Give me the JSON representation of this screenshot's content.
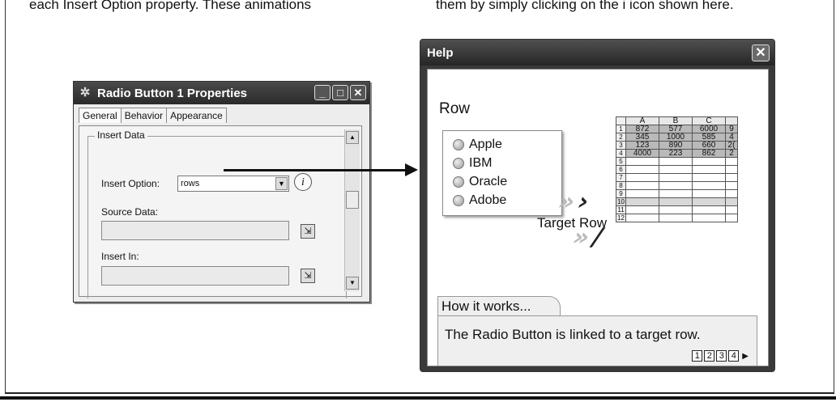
{
  "intro_text": {
    "left": "each Insert Option property. These animations",
    "right": "them by simply clicking on the i icon shown here."
  },
  "properties_window": {
    "title": "Radio Button 1 Properties",
    "tabs": [
      "General",
      "Behavior",
      "Appearance"
    ],
    "group_label": "Insert Data",
    "insert_option_label": "Insert Option:",
    "insert_option_value": "rows",
    "source_data_label": "Source Data:",
    "insert_in_label": "Insert In:"
  },
  "help_window": {
    "title": "Help",
    "section_title": "Row",
    "radio_options": [
      "Apple",
      "IBM",
      "Oracle",
      "Adobe"
    ],
    "target_label": "Target Row",
    "sheet": {
      "columns": [
        "A",
        "B",
        "C"
      ],
      "row_numbers": [
        "1",
        "2",
        "3",
        "4",
        "5",
        "6",
        "7",
        "8",
        "9",
        "10",
        "11",
        "12"
      ],
      "rows": [
        [
          "872",
          "577",
          "6000",
          "9"
        ],
        [
          "345",
          "1000",
          "585",
          "4"
        ],
        [
          "123",
          "890",
          "660",
          "2("
        ],
        [
          "4000",
          "223",
          "862",
          "2"
        ]
      ]
    },
    "how_it_works_label": "How it works...",
    "how_it_works_text": "The Radio Button is linked to a target row.",
    "pager": [
      "1",
      "2",
      "3",
      "4"
    ]
  }
}
